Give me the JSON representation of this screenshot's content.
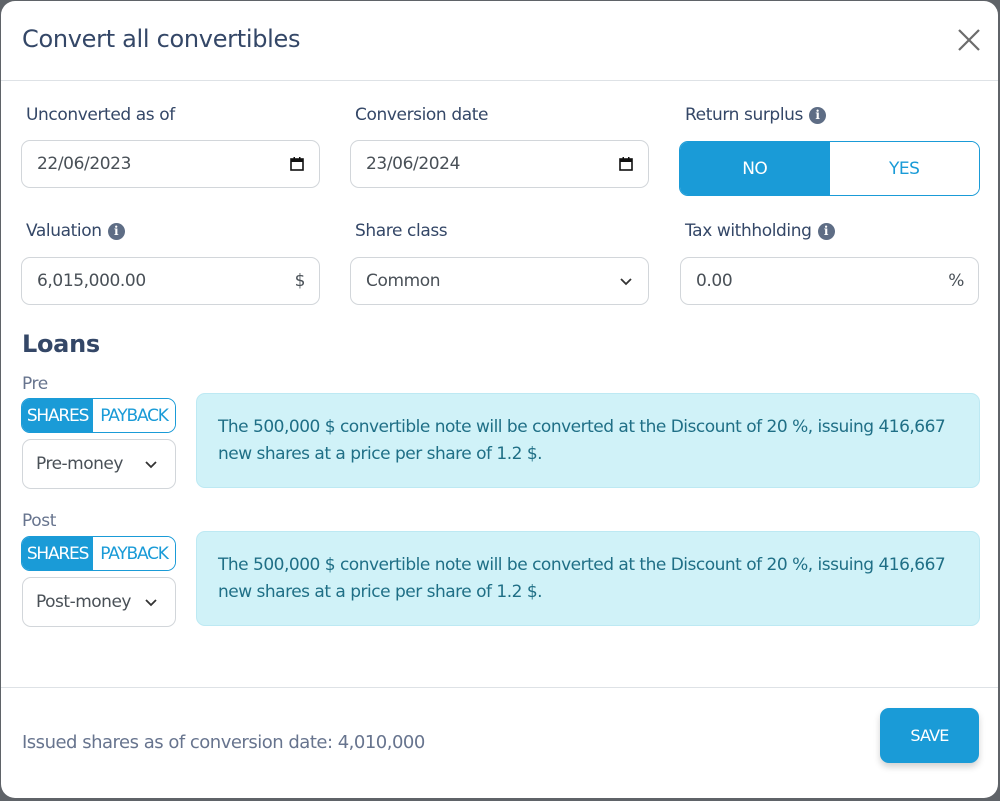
{
  "modal": {
    "title": "Convert all convertibles",
    "close_icon": "close-icon"
  },
  "fields": {
    "unconverted_as_of": {
      "label": "Unconverted as of",
      "value": "22/06/2023",
      "icon": "calendar-icon"
    },
    "conversion_date": {
      "label": "Conversion date",
      "value": "23/06/2024",
      "icon": "calendar-icon"
    },
    "return_surplus": {
      "label": "Return surplus",
      "info_icon": "i",
      "options": [
        "NO",
        "YES"
      ],
      "selected": "NO"
    },
    "valuation": {
      "label": "Valuation",
      "info_icon": "i",
      "value": "6,015,000.00",
      "suffix": "$"
    },
    "share_class": {
      "label": "Share class",
      "value": "Common",
      "icon": "chevron-down-icon"
    },
    "tax_withholding": {
      "label": "Tax withholding",
      "info_icon": "i",
      "value": "0.00",
      "suffix": "%"
    }
  },
  "loans": {
    "title": "Loans",
    "items": [
      {
        "label": "Pre",
        "toggle": {
          "options": [
            "SHARES",
            "PAYBACK"
          ],
          "selected": "SHARES"
        },
        "select_value": "Pre-money",
        "message": "The 500,000 $ convertible note will be converted at the Discount of 20 %, issuing 416,667 new shares at a price per share of 1.2 $."
      },
      {
        "label": "Post",
        "toggle": {
          "options": [
            "SHARES",
            "PAYBACK"
          ],
          "selected": "SHARES"
        },
        "select_value": "Post-money",
        "message": "The 500,000 $ convertible note will be converted at the Discount of 20 %, issuing 416,667 new shares at a price per share of 1.2 $."
      }
    ]
  },
  "footer": {
    "issued_shares_text": "Issued shares as of conversion date: 4,010,000",
    "save_label": "SAVE"
  },
  "colors": {
    "primary": "#1a9bd7",
    "heading": "#344767",
    "muted": "#67748e",
    "alert_bg": "#d0f2f8",
    "alert_text": "#1f6f86"
  }
}
